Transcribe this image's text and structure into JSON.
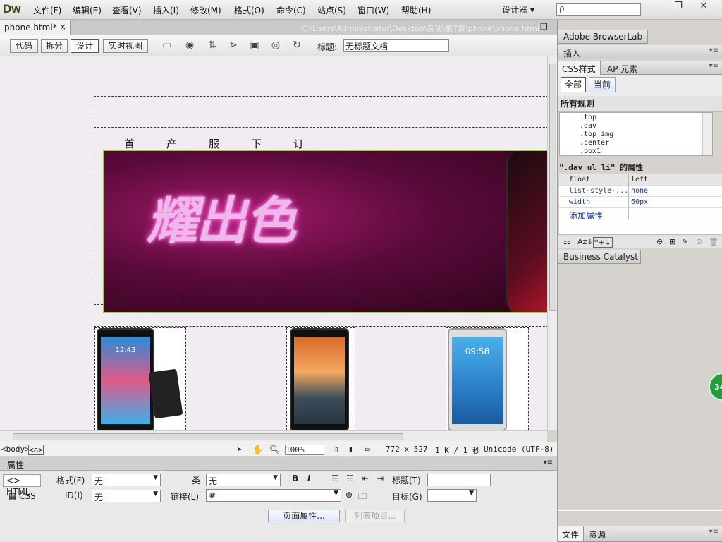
{
  "app": {
    "logo": "Dw",
    "workspace": "设计器 ▾"
  },
  "menu": [
    "文件(F)",
    "编辑(E)",
    "查看(V)",
    "插入(I)",
    "修改(M)",
    "格式(O)",
    "命令(C)",
    "站点(S)",
    "窗口(W)",
    "帮助(H)"
  ],
  "window_controls": {
    "minimize": "—",
    "restore": "❐",
    "close": "✕"
  },
  "search_placeholder": "ρ",
  "document": {
    "tab_name": "phone.html*",
    "tab_close": "×",
    "path": "C:\\Users\\Administrator\\Desktop\\杂项\\第7章\\phone\\phone.html"
  },
  "doc_toolbar": {
    "views": [
      "代码",
      "拆分",
      "设计",
      "实时视图"
    ],
    "active_view": "设计",
    "title_label": "标题:",
    "title_value": "无标题文档"
  },
  "design": {
    "nav": [
      "首页",
      "产品",
      "服务",
      "下载",
      "订购"
    ],
    "banner_text": "耀出色",
    "phone_times": [
      "12:43",
      "09:58"
    ]
  },
  "status": {
    "tags": [
      "<body>",
      "<a>"
    ],
    "zoom": "100%",
    "size": "772 x 527",
    "file_size": "1 K / 1 秒",
    "encoding": "Unicode (UTF-8)"
  },
  "properties": {
    "header": "属性",
    "html_label": "HTML",
    "css_label": "CSS",
    "format_label": "格式(F)",
    "format_value": "无",
    "class_label": "类",
    "class_value": "无",
    "id_label": "ID(I)",
    "id_value": "无",
    "link_label": "链接(L)",
    "link_value": "#",
    "bold": "B",
    "italic": "I",
    "title_label": "标题(T)",
    "title_value": "",
    "target_label": "目标(G)",
    "target_value": "",
    "page_props_button": "页面属性...",
    "list_items_button": "列表项目..."
  },
  "right_panel": {
    "browserlab": "Adobe BrowserLab",
    "insert": "插入",
    "css_tab": "CSS样式",
    "ap_tab": "AP 元素",
    "all_btn": "全部",
    "current_btn": "当前",
    "all_rules_heading": "所有规则",
    "rules": [
      ".top",
      ".dav",
      ".top_img",
      ".center",
      ".box1"
    ],
    "props_heading": "\".dav ul li\" 的属性",
    "props": [
      {
        "name": "float",
        "value": "left"
      },
      {
        "name": "list-style-...",
        "value": "none"
      },
      {
        "name": "width",
        "value": "60px"
      }
    ],
    "add_property": "添加属性",
    "az": "Az↓",
    "star": "*+↓",
    "business_catalyst": "Business Catalyst",
    "files_tab": "文件",
    "assets_tab": "资源"
  },
  "badge": "34"
}
